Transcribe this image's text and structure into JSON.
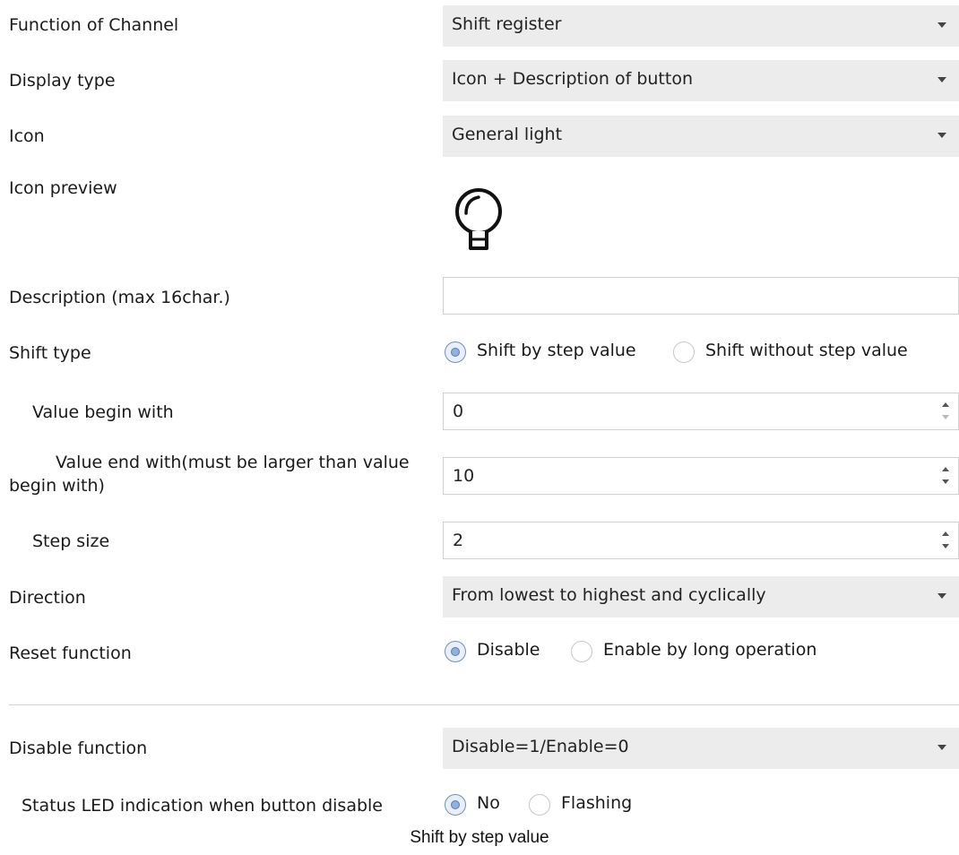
{
  "rows": {
    "function_of_channel": {
      "label": "Function of Channel",
      "value": "Shift register"
    },
    "display_type": {
      "label": "Display type",
      "value": "Icon + Description of button"
    },
    "icon": {
      "label": "Icon",
      "value": "General light"
    },
    "icon_preview": {
      "label": "Icon preview",
      "icon_name": "light-bulb-icon"
    },
    "description": {
      "label": "Description (max 16char.)",
      "value": ""
    },
    "shift_type": {
      "label": "Shift type",
      "options": [
        "Shift by step value",
        "Shift without step value"
      ],
      "selected": "Shift by step value"
    },
    "value_begin": {
      "label": "Value begin with",
      "value": "0"
    },
    "value_end": {
      "label_line1": "Value end with(must be larger than value",
      "label_line2": "begin with)",
      "value": "10"
    },
    "step_size": {
      "label": "Step  size",
      "value": "2"
    },
    "direction": {
      "label": "Direction",
      "value": "From lowest to highest and cyclically"
    },
    "reset_function": {
      "label": "Reset function",
      "options": [
        "Disable",
        "Enable by long operation"
      ],
      "selected": "Disable"
    },
    "disable_function": {
      "label": "Disable function",
      "value": "Disable=1/Enable=0"
    },
    "status_led": {
      "label": "Status LED indication when button disable",
      "options": [
        "No",
        "Flashing"
      ],
      "selected": "No"
    }
  },
  "caption": "Shift by step value",
  "colors": {
    "dropdown_bg": "#ececec",
    "radio_selected": "#8fb0e0",
    "border": "#d0d0d0"
  }
}
